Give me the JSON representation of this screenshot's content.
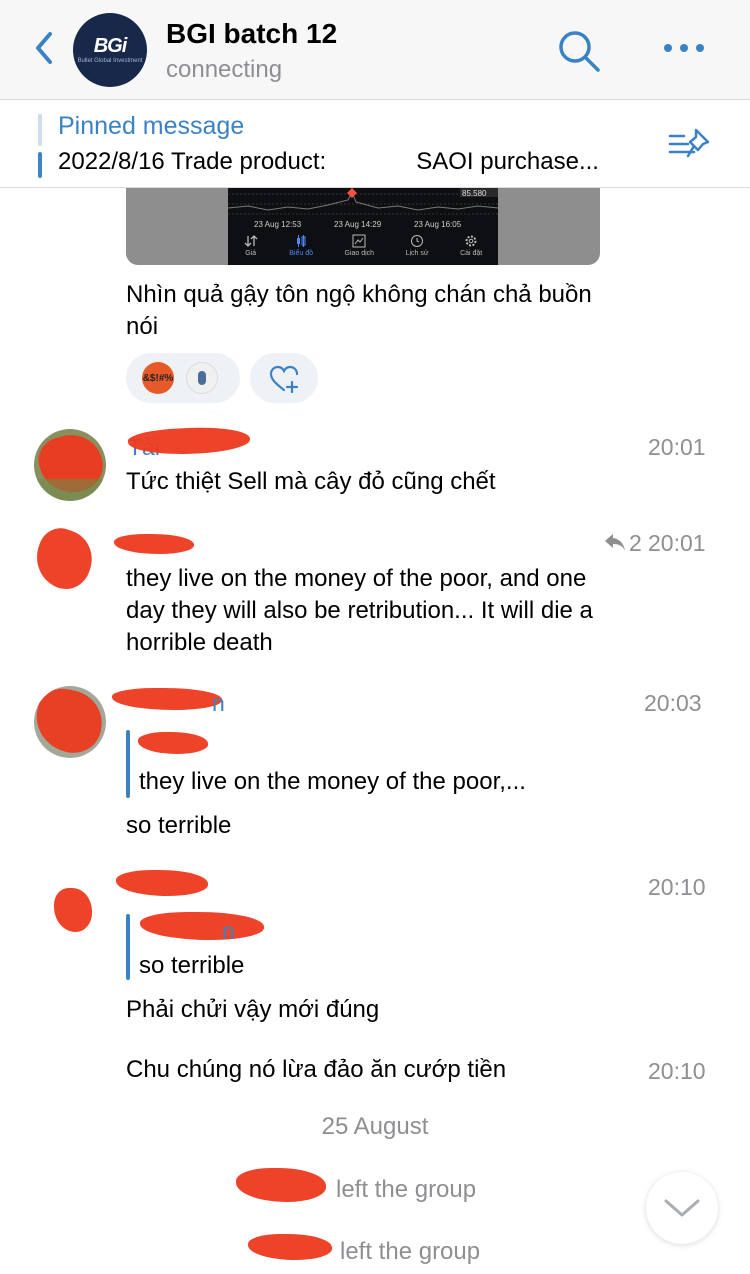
{
  "header": {
    "title": "BGI batch 12",
    "status": "connecting",
    "logo_text": "BGi",
    "logo_sub": "Bullet Global Investment"
  },
  "pinned": {
    "title": "Pinned message",
    "text_left": "2022/8/16 Trade product:",
    "text_right": "SAOI purchase..."
  },
  "image_card": {
    "price": "85.580",
    "times": [
      "23 Aug 12:53",
      "23 Aug 14:29",
      "23 Aug 16:05"
    ],
    "tabs": [
      "Giá",
      "Biểu đồ",
      "Giao dịch",
      "Lịch sử",
      "Cài đặt"
    ]
  },
  "messages": {
    "m1_text": "Nhìn quả gậy tôn ngộ không chán chả buồn nói",
    "m1_reaction_emoji": "&$!#%",
    "m2_name": "Tài",
    "m2_text": "Tức thiệt Sell mà cây đỏ cũng chết",
    "m2_time": "20:01",
    "m3_text": "they live on the money of the poor, and one day they will also be retribution... It will die a horrible death",
    "m3_replies": "2",
    "m3_time": "20:01",
    "m4_name_tail": "n",
    "m4_reply_text": "they live on the money of the poor,...",
    "m4_text": "so terrible",
    "m4_time": "20:03",
    "m5_reply_name_tail": "n",
    "m5_reply_text": "so terrible",
    "m5_text": "Phải chửi vậy mới đúng",
    "m5_time": "20:10",
    "m6_text": "Chu chúng nó lừa đảo ăn cướp tiền",
    "m6_time": "20:10"
  },
  "date_separator": "25 August",
  "service": {
    "left_1": "left the group",
    "left_2": "left the group"
  },
  "colors": {
    "accent": "#3b82c4",
    "meta": "#8e8e93",
    "redaction": "#ec3a1e"
  },
  "icons": [
    "back-chevron-icon",
    "search-icon",
    "more-icon",
    "pinned-list-icon",
    "add-reaction-icon",
    "reply-arrow-icon",
    "chevron-down-icon"
  ]
}
